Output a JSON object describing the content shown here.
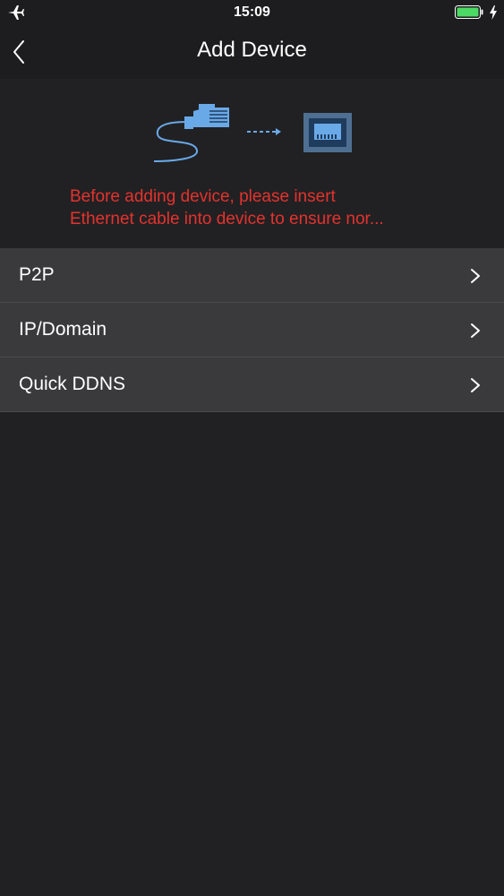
{
  "status_bar": {
    "time": "15:09",
    "airplane_icon": "airplane-icon",
    "battery_icon": "battery-icon",
    "charging_icon": "bolt-icon",
    "battery_level": 1.0,
    "battery_color": "#4cd964"
  },
  "nav": {
    "title": "Add Device",
    "back_icon": "chevron-left-icon"
  },
  "hint": {
    "illustration_icon": "ethernet-cable-to-port-icon",
    "line1": "Before adding device, please insert",
    "line2": "Ethernet cable into device to ensure nor...",
    "color": "#e5322d"
  },
  "menu": {
    "items": [
      {
        "label": "P2P",
        "icon": "chevron-right-icon"
      },
      {
        "label": "IP/Domain",
        "icon": "chevron-right-icon"
      },
      {
        "label": "Quick DDNS",
        "icon": "chevron-right-icon"
      }
    ]
  },
  "colors": {
    "background": "#212123",
    "header": "#1d1d1f",
    "row": "#3a3a3c",
    "accent_blue": "#6aa9e8"
  }
}
